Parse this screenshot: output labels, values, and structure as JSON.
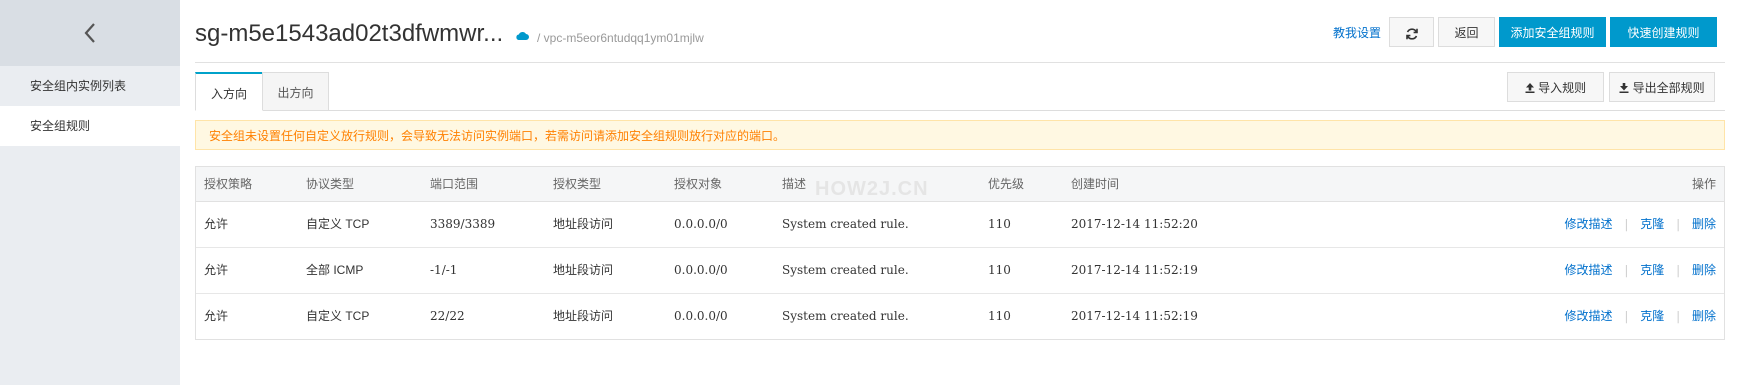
{
  "sidebar": {
    "items": [
      {
        "label": "安全组内实例列表"
      },
      {
        "label": "安全组规则"
      }
    ]
  },
  "header": {
    "title": "sg-m5e1543ad02t3dfwmwr...",
    "vpc": "/ vpc-m5eor6ntudqq1ym01mjlw",
    "help_label": "教我设置",
    "back_label": "返回",
    "add_rule_label": "添加安全组规则",
    "quick_create_label": "快速创建规则"
  },
  "tabs": [
    {
      "label": "入方向"
    },
    {
      "label": "出方向"
    }
  ],
  "toolbar": {
    "import_label": "导入规则",
    "export_label": "导出全部规则"
  },
  "notice": "安全组未设置任何自定义放行规则，会导致无法访问实例端口，若需访问请添加安全组规则放行对应的端口。",
  "watermark": "HOW2J.CN",
  "table": {
    "headers": [
      "授权策略",
      "协议类型",
      "端口范围",
      "授权类型",
      "授权对象",
      "描述",
      "优先级",
      "创建时间",
      "操作"
    ],
    "rows": [
      [
        "允许",
        "自定义 TCP",
        "3389/3389",
        "地址段访问",
        "0.0.0.0/0",
        "System created rule.",
        "110",
        "2017-12-14 11:52:20"
      ],
      [
        "允许",
        "全部 ICMP",
        "-1/-1",
        "地址段访问",
        "0.0.0.0/0",
        "System created rule.",
        "110",
        "2017-12-14 11:52:19"
      ],
      [
        "允许",
        "自定义 TCP",
        "22/22",
        "地址段访问",
        "0.0.0.0/0",
        "System created rule.",
        "110",
        "2017-12-14 11:52:19"
      ]
    ],
    "actions": [
      "修改描述",
      "克隆",
      "删除"
    ],
    "separator": "|"
  },
  "colors": {
    "primary": "#0099cc",
    "link": "#0070cc",
    "notice_text": "#ff8000",
    "notice_bg": "#fff8e2"
  },
  "icons": {
    "back": "chevron-left-icon",
    "cloud": "cloud-icon",
    "refresh": "refresh-icon",
    "import": "upload-icon",
    "export": "download-icon"
  }
}
